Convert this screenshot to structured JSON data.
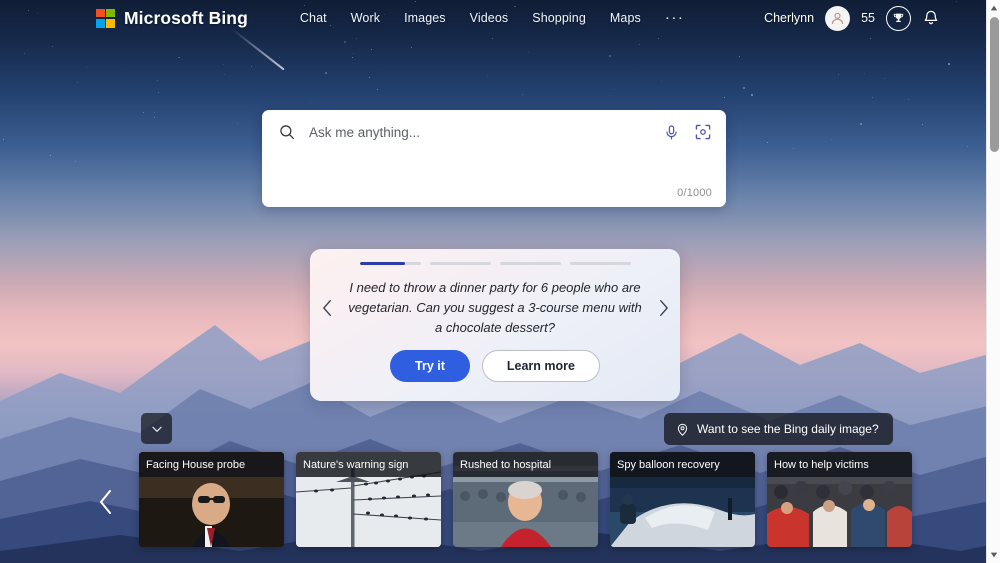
{
  "header": {
    "brand": "Microsoft Bing",
    "logo_colors": {
      "red": "#f25022",
      "green": "#7fba00",
      "blue": "#00a4ef",
      "yellow": "#ffb900"
    },
    "nav": [
      {
        "label": "Chat",
        "name": "nav-chat"
      },
      {
        "label": "Work",
        "name": "nav-work"
      },
      {
        "label": "Images",
        "name": "nav-images"
      },
      {
        "label": "Videos",
        "name": "nav-videos"
      },
      {
        "label": "Shopping",
        "name": "nav-shopping"
      },
      {
        "label": "Maps",
        "name": "nav-maps"
      }
    ],
    "more_label": "···",
    "user_name": "Cherlynn",
    "rewards_points": "55",
    "avatar_icon": "person-icon",
    "rewards_icon": "trophy-icon",
    "notifications_icon": "bell-icon",
    "menu_icon": "hamburger-icon"
  },
  "search": {
    "placeholder": "Ask me anything...",
    "value": "",
    "counter": "0/1000",
    "search_icon": "search-icon",
    "mic_icon": "microphone-icon",
    "visual_icon": "visual-search-icon"
  },
  "suggestion": {
    "prompt": "I need to throw a dinner party for 6 people who are vegetarian. Can you suggest a 3-course menu with a chocolate dessert?",
    "try_label": "Try it",
    "learn_label": "Learn more",
    "prev_icon": "chevron-left-icon",
    "next_icon": "chevron-right-icon",
    "progress": [
      75,
      0,
      0,
      0
    ],
    "accent": "#2b3da8",
    "primary_button_color": "#2f5ee0"
  },
  "daily_image": {
    "label": "Want to see the Bing daily image?",
    "icon": "location-pin-icon"
  },
  "collapse": {
    "icon": "chevron-down-icon"
  },
  "carousel": {
    "prev_icon": "chevron-left-icon",
    "next_icon": "chevron-right-icon",
    "cards": [
      {
        "title": "Facing House probe"
      },
      {
        "title": "Nature's warning sign"
      },
      {
        "title": "Rushed to hospital"
      },
      {
        "title": "Spy balloon recovery"
      },
      {
        "title": "How to help victims"
      }
    ]
  },
  "scrollbar": {
    "up_icon": "scroll-up-icon",
    "down_icon": "scroll-down-icon"
  }
}
